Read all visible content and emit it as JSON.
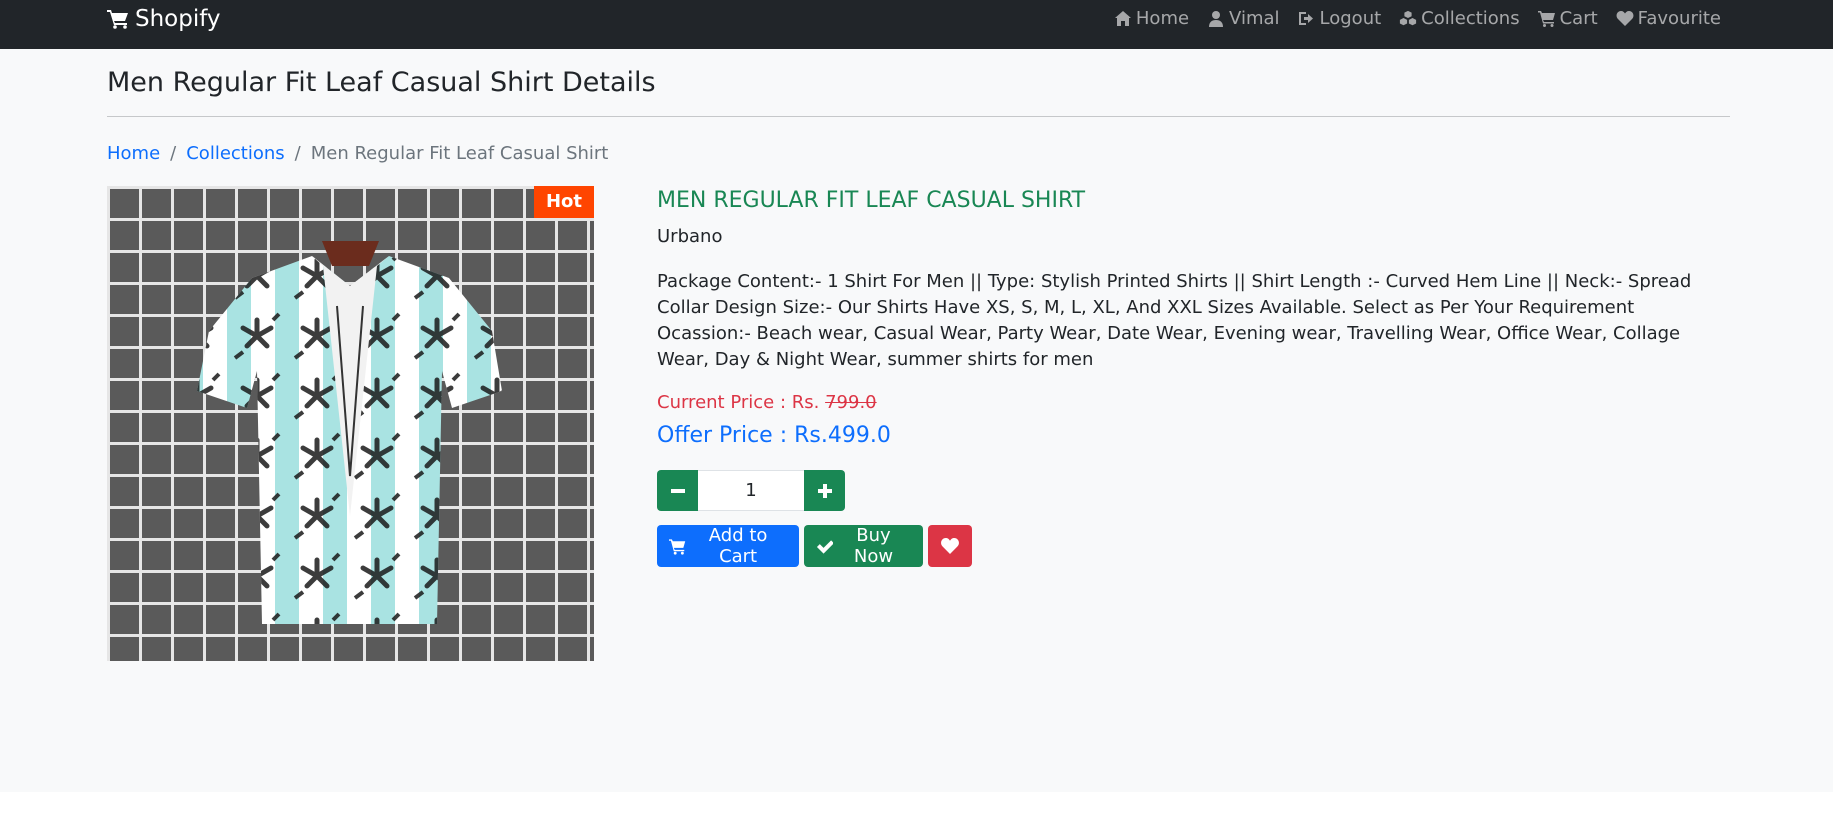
{
  "navbar": {
    "brand": "Shopify",
    "links": {
      "home": "Home",
      "user": "Vimal",
      "logout": "Logout",
      "collections": "Collections",
      "cart": "Cart",
      "favourite": "Favourite"
    }
  },
  "page": {
    "title": "Men Regular Fit Leaf Casual Shirt Details"
  },
  "breadcrumb": {
    "home": "Home",
    "separator": "/",
    "collections": "Collections",
    "current": "Men Regular Fit Leaf Casual Shirt"
  },
  "product": {
    "badge": "Hot",
    "name": "MEN REGULAR FIT LEAF CASUAL SHIRT",
    "brand": "Urbano",
    "description": "Package Content:- 1 Shirt For Men || Type: Stylish Printed Shirts || Shirt Length :- Curved Hem Line || Neck:- Spread Collar Design Size:- Our Shirts Have XS, S, M, L, XL, And XXL Sizes Available. Select as Per Your Requirement Ocassion:- Beach wear, Casual Wear, Party Wear, Date Wear, Evening wear, Travelling Wear, Office Wear, Collage Wear, Day & Night Wear, summer shirts for men",
    "current_price_label": "Current Price : Rs.",
    "current_price_value": "799.0",
    "offer_price": "Offer Price : Rs.499.0",
    "quantity": "1",
    "image_icon": "shirt-photo"
  },
  "actions": {
    "add_to_cart": "Add to Cart",
    "buy_now": "Buy Now",
    "favourite_icon": "heart-icon"
  },
  "colors": {
    "navbar_bg": "#212529",
    "success": "#198754",
    "primary": "#0d6efd",
    "danger": "#dc3545",
    "badge": "#ff4500"
  }
}
